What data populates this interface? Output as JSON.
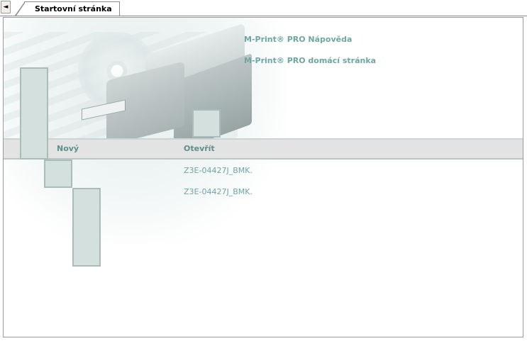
{
  "tabs": {
    "scroll_left_glyph": "◄",
    "active_label": "Startovní stránka"
  },
  "links": {
    "help": "M-Print® PRO Nápověda",
    "home": "M-Print® PRO domácí stránka"
  },
  "columns": {
    "new": "Nový",
    "open": "Otevřít"
  },
  "recent_files": [
    "Z3E-04427J_BMK.",
    "Z3E-04427J_BMK."
  ],
  "colors": {
    "accent": "#6ea6a2",
    "band": "#e3e3e3",
    "block": "#d4e0de"
  }
}
